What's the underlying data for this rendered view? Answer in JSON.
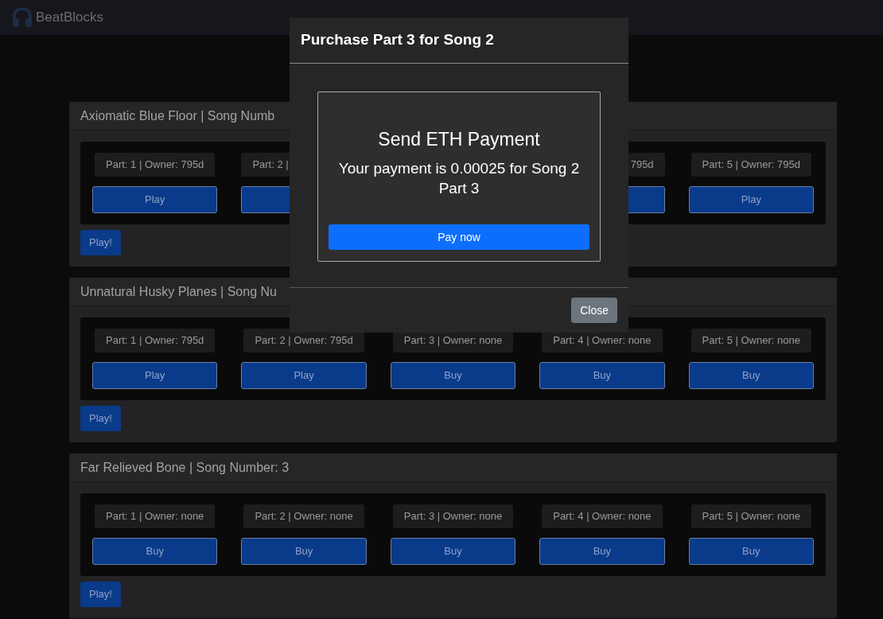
{
  "navbar": {
    "brand": "BeatBlocks"
  },
  "songs": [
    {
      "title": "Axiomatic Blue Floor | Song Numb",
      "parts": [
        {
          "kind": "full",
          "label": "Part: 1 | Owner: 795d",
          "button": "Play"
        },
        {
          "kind": "cut_right",
          "label": "Part: 2 |"
        },
        {
          "kind": "hidden"
        },
        {
          "kind": "cut_left",
          "label": "795d"
        },
        {
          "kind": "full",
          "label": "Part: 5 | Owner: 795d",
          "button": "Play"
        }
      ],
      "play_all": "Play!"
    },
    {
      "title": "Unnatural Husky Planes | Song Nu",
      "parts": [
        {
          "kind": "full",
          "label": "Part: 1 | Owner: 795d",
          "button": "Play"
        },
        {
          "kind": "full",
          "label": "Part: 2 | Owner: 795d",
          "button": "Play"
        },
        {
          "kind": "full",
          "label": "Part: 3 | Owner: none",
          "button": "Buy"
        },
        {
          "kind": "full",
          "label": "Part: 4 | Owner: none",
          "button": "Buy"
        },
        {
          "kind": "full",
          "label": "Part: 5 | Owner: none",
          "button": "Buy"
        }
      ],
      "play_all": "Play!"
    },
    {
      "title": "Far Relieved Bone | Song Number: 3",
      "parts": [
        {
          "kind": "full",
          "label": "Part: 1 | Owner: none",
          "button": "Buy"
        },
        {
          "kind": "full",
          "label": "Part: 2 | Owner: none",
          "button": "Buy"
        },
        {
          "kind": "full",
          "label": "Part: 3 | Owner: none",
          "button": "Buy"
        },
        {
          "kind": "full",
          "label": "Part: 4 | Owner: none",
          "button": "Buy"
        },
        {
          "kind": "full",
          "label": "Part: 5 | Owner: none",
          "button": "Buy"
        }
      ],
      "play_all": "Play!"
    }
  ],
  "modal": {
    "title": "Purchase Part 3 for Song 2",
    "heading": "Send ETH Payment",
    "message": "Your payment is 0.00025 for Song 2 Part 3",
    "pay_button": "Pay now",
    "close_button": "Close"
  }
}
